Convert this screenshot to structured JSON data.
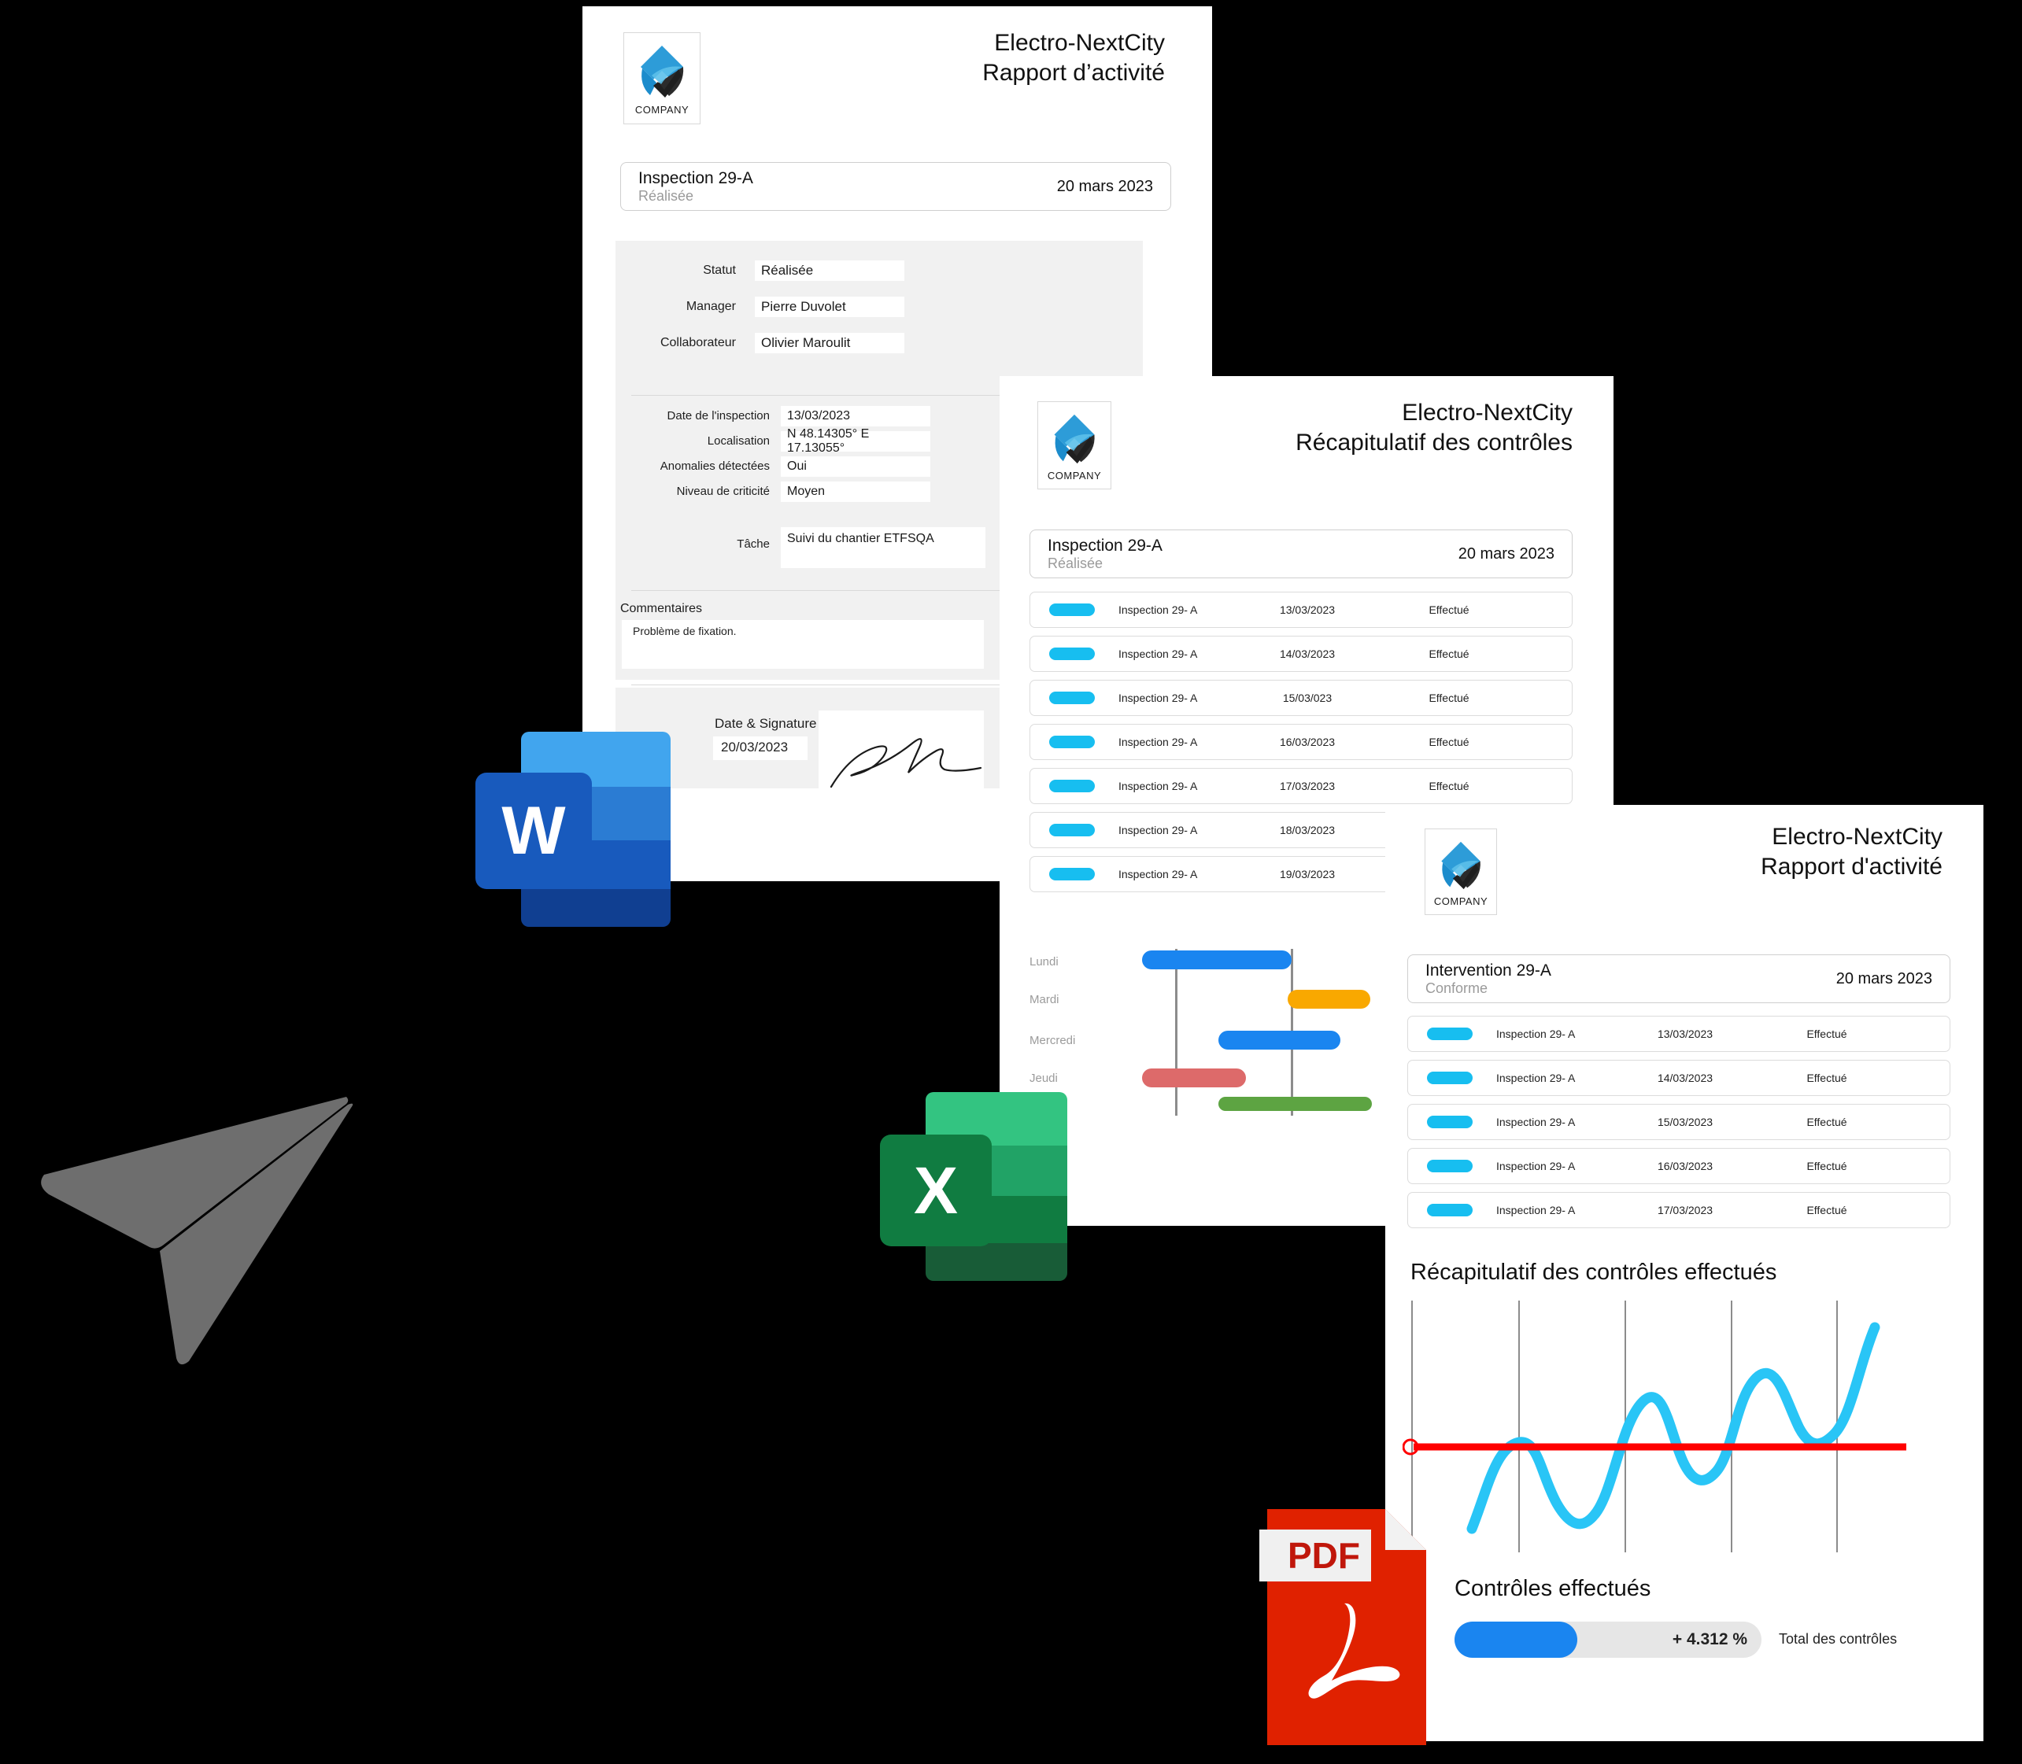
{
  "company": {
    "logo_caption": "COMPANY",
    "name": "Electro-NextCity"
  },
  "doc1": {
    "title_line1": "Electro-NextCity",
    "title_line2": "Rapport d’activité",
    "summary": {
      "name": "Inspection 29-A",
      "state": "Réalisée",
      "date": "20 mars 2023"
    },
    "fields_top": [
      {
        "label": "Statut",
        "value": "Réalisée"
      },
      {
        "label": "Manager",
        "value": "Pierre Duvolet"
      },
      {
        "label": "Collaborateur",
        "value": "Olivier Maroulit"
      }
    ],
    "fields_mid": [
      {
        "label": "Date de l'inspection",
        "value": "13/03/2023"
      },
      {
        "label": "Localisation",
        "value": "N 48.14305° E 17.13055°"
      },
      {
        "label": "Anomalies détectées",
        "value": "Oui"
      },
      {
        "label": "Niveau de criticité",
        "value": "Moyen"
      }
    ],
    "task": {
      "label": "Tâche",
      "value": "Suivi du chantier ETFSQA"
    },
    "comments": {
      "label": "Commentaires",
      "value": "Problème de fixation."
    },
    "signature": {
      "label": "Date & Signature",
      "date": "20/03/2023"
    }
  },
  "doc2": {
    "title_line1": "Electro-NextCity",
    "title_line2": "Récapitulatif des contrôles",
    "summary": {
      "name": "Inspection 29-A",
      "state": "Réalisée",
      "date": "20 mars 2023"
    },
    "rows": [
      {
        "label": "Inspection 29- A",
        "date": "13/03/2023",
        "status": "Effectué"
      },
      {
        "label": "Inspection 29- A",
        "date": "14/03/2023",
        "status": "Effectué"
      },
      {
        "label": "Inspection 29- A",
        "date": "15/03/023",
        "status": "Effectué"
      },
      {
        "label": "Inspection 29- A",
        "date": "16/03/2023",
        "status": "Effectué"
      },
      {
        "label": "Inspection 29- A",
        "date": "17/03/2023",
        "status": "Effectué"
      },
      {
        "label": "Inspection 29- A",
        "date": "18/03/2023",
        "status": ""
      },
      {
        "label": "Inspection 29- A",
        "date": "19/03/2023",
        "status": ""
      }
    ]
  },
  "doc3": {
    "title_line1": "Electro-NextCity",
    "title_line2": "Rapport d'activité",
    "summary": {
      "name": "Intervention 29-A",
      "state": "Conforme",
      "date": "20 mars 2023"
    },
    "rows": [
      {
        "label": "Inspection 29- A",
        "date": "13/03/2023",
        "status": "Effectué"
      },
      {
        "label": "Inspection 29- A",
        "date": "14/03/2023",
        "status": "Effectué"
      },
      {
        "label": "Inspection 29- A",
        "date": "15/03/2023",
        "status": "Effectué"
      },
      {
        "label": "Inspection 29- A",
        "date": "16/03/2023",
        "status": "Effectué"
      },
      {
        "label": "Inspection 29- A",
        "date": "17/03/2023",
        "status": "Effectué"
      }
    ],
    "chart_title": "Récapitulatif des contrôles effectués",
    "kpi_title": "Contrôles effectués",
    "kpi_value": "+ 4.312 %",
    "kpi_caption": "Total des contrôles"
  },
  "gantt": {
    "labels": [
      "Lundi",
      "Mardi",
      "Mercredi",
      "Jeudi"
    ],
    "bars": [
      {
        "day": "Lundi",
        "color": "#1a85f0",
        "left": 43,
        "width": 190,
        "top": 10
      },
      {
        "day": "Mardi",
        "color": "#f9a800",
        "left": 228,
        "width": 105,
        "top": 57
      },
      {
        "day": "Mercredi",
        "color": "#1a85f0",
        "left": 140,
        "width": 155,
        "top": 112
      },
      {
        "day": "Jeudi",
        "color": "#dd6a6a",
        "left": 43,
        "width": 132,
        "top": 160
      },
      {
        "day": "Jeudi-2",
        "color": "#5da442",
        "left": 140,
        "width": 195,
        "top": 196
      }
    ]
  },
  "chart_data": {
    "type": "line",
    "title": "Récapitulatif des contrôles effectués",
    "xlabel": "",
    "ylabel": "",
    "grid": true,
    "legend": "none",
    "series": [
      {
        "name": "Contrôles effectués",
        "color": "#29c5f6",
        "x": [
          0,
          4,
          8,
          12,
          16,
          20,
          24,
          28,
          32,
          36,
          40,
          44,
          48,
          52,
          56,
          60,
          64,
          68,
          72,
          76,
          80,
          84,
          88,
          92,
          96,
          100
        ],
        "y": [
          8,
          18,
          34,
          50,
          57,
          54,
          44,
          30,
          16,
          8,
          12,
          28,
          48,
          66,
          72,
          66,
          50,
          34,
          26,
          34,
          58,
          78,
          86,
          80,
          60,
          96
        ]
      }
    ],
    "reference_line": {
      "value": 52,
      "color": "#ff0000",
      "marker": "circle"
    },
    "gridlines_x": [
      2,
      22,
      42,
      62,
      82
    ],
    "ylim": [
      0,
      100
    ],
    "xlim": [
      0,
      100
    ]
  },
  "kpi_chart": {
    "type": "bar",
    "title": "Contrôles effectués",
    "categories": [
      "Total des contrôles"
    ],
    "values": [
      4.312
    ],
    "value_label": "+ 4.312 %",
    "fill_percent": 40,
    "accent": "#1a85f0"
  },
  "app_icons": {
    "word": {
      "letter": "W",
      "name": "Microsoft Word",
      "colors": [
        "#41a5ee",
        "#2b7cd3",
        "#185abd",
        "#103f91"
      ]
    },
    "excel": {
      "letter": "X",
      "name": "Microsoft Excel",
      "colors": [
        "#33c481",
        "#21a366",
        "#107c41",
        "#185c37"
      ]
    },
    "pdf": {
      "label": "PDF",
      "name": "Adobe PDF",
      "color": "#e02100"
    }
  },
  "send_icon": {
    "name": "paper-plane",
    "color": "#6e6e6e"
  }
}
